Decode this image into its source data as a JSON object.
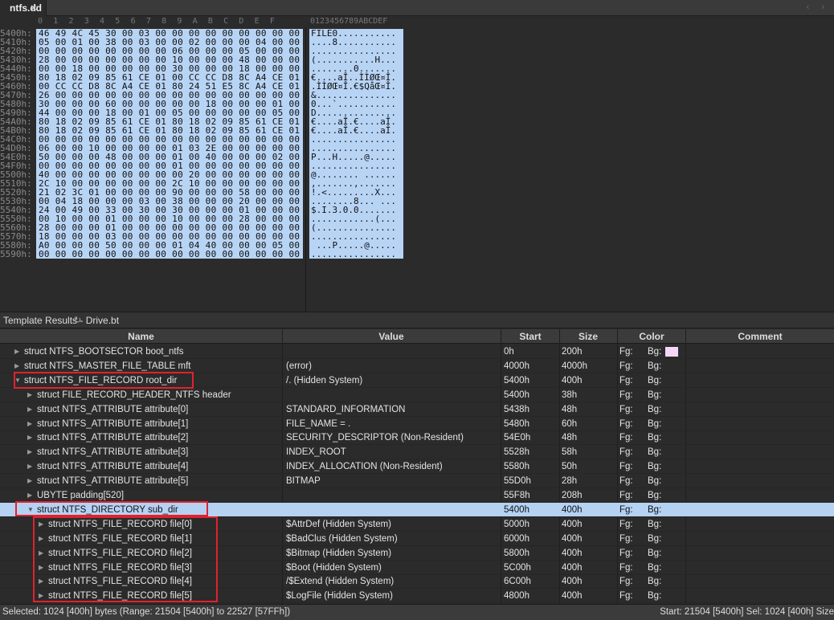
{
  "tab": {
    "title": "ntfs.dd",
    "close_label": "×"
  },
  "nav_arrows": "‹ ›",
  "hex": {
    "header_cols": "0  1  2  3  4  5  6  7  8  9  A  B  C  D  E  F",
    "header_ascii": "0123456789ABCDEF",
    "rows": [
      {
        "addr": "5400h:",
        "bytes": "46 49 4C 45 30 00 03 00 00 00 00 00 00 00 00 00",
        "ascii": "FILE0..........."
      },
      {
        "addr": "5410h:",
        "bytes": "05 00 01 00 38 00 03 00 00 02 00 00 00 04 00 00",
        "ascii": "....8..........."
      },
      {
        "addr": "5420h:",
        "bytes": "00 00 00 00 00 00 00 00 06 00 00 00 05 00 00 00",
        "ascii": "................"
      },
      {
        "addr": "5430h:",
        "bytes": "28 00 00 00 00 00 00 00 10 00 00 00 48 00 00 00",
        "ascii": "(...........H..."
      },
      {
        "addr": "5440h:",
        "bytes": "00 00 18 00 00 00 00 00 30 00 00 00 18 00 00 00",
        "ascii": "........0......."
      },
      {
        "addr": "5450h:",
        "bytes": "80 18 02 09 85 61 CE 01 00 CC CC D8 8C A4 CE 01",
        "ascii": "€....aÎ..ÌÌØŒ¤Î."
      },
      {
        "addr": "5460h:",
        "bytes": "00 CC CC D8 8C A4 CE 01 80 24 51 E5 8C A4 CE 01",
        "ascii": ".ÌÌØŒ¤Î.€$QåŒ¤Î."
      },
      {
        "addr": "5470h:",
        "bytes": "26 00 00 00 00 00 00 00 00 00 00 00 00 00 00 00",
        "ascii": "&..............."
      },
      {
        "addr": "5480h:",
        "bytes": "30 00 00 00 60 00 00 00 00 00 18 00 00 00 01 00",
        "ascii": "0...`..........."
      },
      {
        "addr": "5490h:",
        "bytes": "44 00 00 00 18 00 01 00 05 00 00 00 00 00 05 00",
        "ascii": "D..............."
      },
      {
        "addr": "54A0h:",
        "bytes": "80 18 02 09 85 61 CE 01 80 18 02 09 85 61 CE 01",
        "ascii": "€....aÎ.€....aÎ."
      },
      {
        "addr": "54B0h:",
        "bytes": "80 18 02 09 85 61 CE 01 80 18 02 09 85 61 CE 01",
        "ascii": "€....aÎ.€....aÎ."
      },
      {
        "addr": "54C0h:",
        "bytes": "00 00 00 00 00 00 00 00 00 00 00 00 00 00 00 00",
        "ascii": "................"
      },
      {
        "addr": "54D0h:",
        "bytes": "06 00 00 10 00 00 00 00 01 03 2E 00 00 00 00 00",
        "ascii": "................"
      },
      {
        "addr": "54E0h:",
        "bytes": "50 00 00 00 48 00 00 00 01 00 40 00 00 00 02 00",
        "ascii": "P...H.....@....."
      },
      {
        "addr": "54F0h:",
        "bytes": "00 00 00 00 00 00 00 00 01 00 00 00 00 00 00 00",
        "ascii": "................"
      },
      {
        "addr": "5500h:",
        "bytes": "40 00 00 00 00 00 00 00 00 20 00 00 00 00 00 00",
        "ascii": "@........ ......"
      },
      {
        "addr": "5510h:",
        "bytes": "2C 10 00 00 00 00 00 00 2C 10 00 00 00 00 00 00",
        "ascii": ",.......,......."
      },
      {
        "addr": "5520h:",
        "bytes": "21 02 3C 01 00 00 00 00 90 00 00 00 58 00 00 00",
        "ascii": "!.<.........X..."
      },
      {
        "addr": "5530h:",
        "bytes": "00 04 18 00 00 00 03 00 38 00 00 00 20 00 00 00",
        "ascii": "........8... ..."
      },
      {
        "addr": "5540h:",
        "bytes": "24 00 49 00 33 00 30 00 30 00 00 00 01 00 00 00",
        "ascii": "$.I.3.0.0......."
      },
      {
        "addr": "5550h:",
        "bytes": "00 10 00 00 01 00 00 00 10 00 00 00 28 00 00 00",
        "ascii": "............(..."
      },
      {
        "addr": "5560h:",
        "bytes": "28 00 00 00 01 00 00 00 00 00 00 00 00 00 00 00",
        "ascii": "(..............."
      },
      {
        "addr": "5570h:",
        "bytes": "18 00 00 00 03 00 00 00 00 00 00 00 00 00 00 00",
        "ascii": "................"
      },
      {
        "addr": "5580h:",
        "bytes": "A0 00 00 00 50 00 00 00 01 04 40 00 00 00 05 00",
        "ascii": " ...P.....@....."
      },
      {
        "addr": "5590h:",
        "bytes": "00 00 00 00 00 00 00 00 00 00 00 00 00 00 00 00",
        "ascii": "................"
      }
    ]
  },
  "template": {
    "title": "Template Results - Drive.bt",
    "refresh_icon": "↻"
  },
  "columns": {
    "name": "Name",
    "value": "Value",
    "start": "Start",
    "size": "Size",
    "color": "Color",
    "comment": "Comment"
  },
  "rows": [
    {
      "name": "struct NTFS_BOOTSECTOR boot_ntfs",
      "value": "",
      "start": "0h",
      "size": "200h",
      "fg": "Fg:",
      "bg": "Bg:",
      "indent": 0,
      "expanded": false,
      "bg_swatch": "#f7d6f5"
    },
    {
      "name": "struct NTFS_MASTER_FILE_TABLE mft",
      "value": "(error)",
      "start": "4000h",
      "size": "4000h",
      "fg": "Fg:",
      "bg": "Bg:",
      "indent": 0,
      "expanded": false
    },
    {
      "name": "struct NTFS_FILE_RECORD root_dir",
      "value": "/. (Hidden System)",
      "start": "5400h",
      "size": "400h",
      "fg": "Fg:",
      "bg": "Bg:",
      "indent": 0,
      "expanded": true
    },
    {
      "name": "struct FILE_RECORD_HEADER_NTFS header",
      "value": "",
      "start": "5400h",
      "size": "38h",
      "fg": "Fg:",
      "bg": "Bg:",
      "indent": 1,
      "expanded": false
    },
    {
      "name": "struct NTFS_ATTRIBUTE attribute[0]",
      "value": "STANDARD_INFORMATION",
      "start": "5438h",
      "size": "48h",
      "fg": "Fg:",
      "bg": "Bg:",
      "indent": 1,
      "expanded": false
    },
    {
      "name": "struct NTFS_ATTRIBUTE attribute[1]",
      "value": "FILE_NAME = .",
      "start": "5480h",
      "size": "60h",
      "fg": "Fg:",
      "bg": "Bg:",
      "indent": 1,
      "expanded": false
    },
    {
      "name": "struct NTFS_ATTRIBUTE attribute[2]",
      "value": "SECURITY_DESCRIPTOR (Non-Resident)",
      "start": "54E0h",
      "size": "48h",
      "fg": "Fg:",
      "bg": "Bg:",
      "indent": 1,
      "expanded": false
    },
    {
      "name": "struct NTFS_ATTRIBUTE attribute[3]",
      "value": "INDEX_ROOT",
      "start": "5528h",
      "size": "58h",
      "fg": "Fg:",
      "bg": "Bg:",
      "indent": 1,
      "expanded": false
    },
    {
      "name": "struct NTFS_ATTRIBUTE attribute[4]",
      "value": "INDEX_ALLOCATION (Non-Resident)",
      "start": "5580h",
      "size": "50h",
      "fg": "Fg:",
      "bg": "Bg:",
      "indent": 1,
      "expanded": false
    },
    {
      "name": "struct NTFS_ATTRIBUTE attribute[5]",
      "value": "BITMAP",
      "start": "55D0h",
      "size": "28h",
      "fg": "Fg:",
      "bg": "Bg:",
      "indent": 1,
      "expanded": false
    },
    {
      "name": "UBYTE padding[520]",
      "value": "",
      "start": "55F8h",
      "size": "208h",
      "fg": "Fg:",
      "bg": "Bg:",
      "indent": 1,
      "expanded": false
    },
    {
      "name": "struct NTFS_DIRECTORY sub_dir",
      "value": "",
      "start": "5400h",
      "size": "400h",
      "fg": "Fg:",
      "bg": "Bg:",
      "indent": 1,
      "expanded": true,
      "selected": true
    },
    {
      "name": "struct NTFS_FILE_RECORD file[0]",
      "value": "$AttrDef (Hidden System)",
      "start": "5000h",
      "size": "400h",
      "fg": "Fg:",
      "bg": "Bg:",
      "indent": 2,
      "expanded": false
    },
    {
      "name": "struct NTFS_FILE_RECORD file[1]",
      "value": "$BadClus (Hidden System)",
      "start": "6000h",
      "size": "400h",
      "fg": "Fg:",
      "bg": "Bg:",
      "indent": 2,
      "expanded": false
    },
    {
      "name": "struct NTFS_FILE_RECORD file[2]",
      "value": "$Bitmap (Hidden System)",
      "start": "5800h",
      "size": "400h",
      "fg": "Fg:",
      "bg": "Bg:",
      "indent": 2,
      "expanded": false
    },
    {
      "name": "struct NTFS_FILE_RECORD file[3]",
      "value": "$Boot (Hidden System)",
      "start": "5C00h",
      "size": "400h",
      "fg": "Fg:",
      "bg": "Bg:",
      "indent": 2,
      "expanded": false
    },
    {
      "name": "struct NTFS_FILE_RECORD file[4]",
      "value": "/$Extend (Hidden System)",
      "start": "6C00h",
      "size": "400h",
      "fg": "Fg:",
      "bg": "Bg:",
      "indent": 2,
      "expanded": false
    },
    {
      "name": "struct NTFS_FILE_RECORD file[5]",
      "value": "$LogFile (Hidden System)",
      "start": "4800h",
      "size": "400h",
      "fg": "Fg:",
      "bg": "Bg:",
      "indent": 2,
      "expanded": false
    }
  ],
  "status": {
    "left": "Selected: 1024 [400h] bytes (Range: 21504 [5400h] to 22527 [57FFh])",
    "right": "Start: 21504 [5400h]   Sel: 1024 [400h]   Size"
  },
  "colors": {
    "selection": "#b8d4f5",
    "highlight_box": "#e0222c"
  }
}
